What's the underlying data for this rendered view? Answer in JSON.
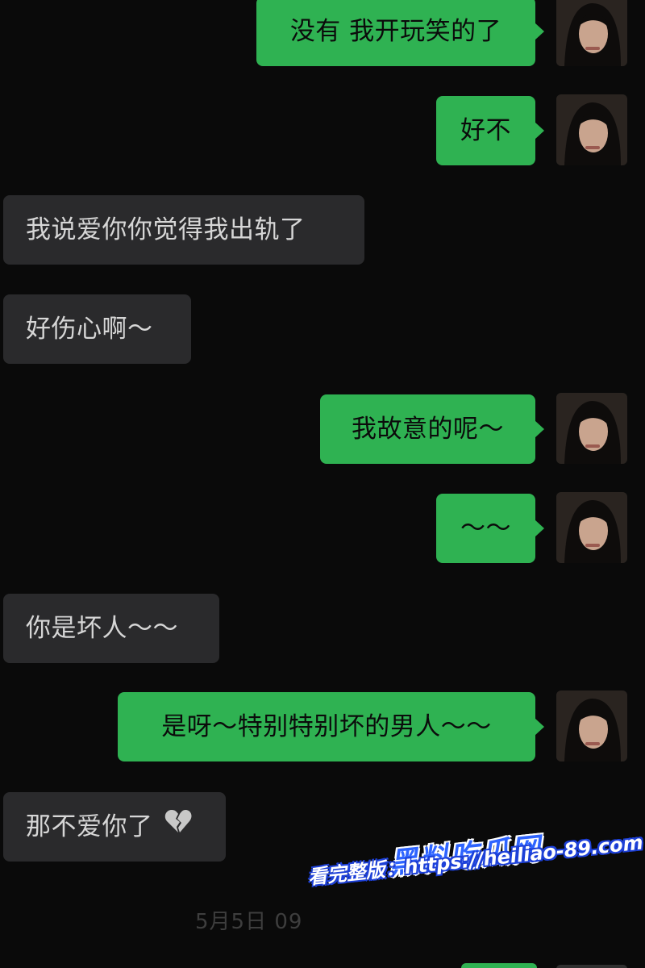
{
  "messages": [
    {
      "side": "sent",
      "text": "没有 我开玩笑的了"
    },
    {
      "side": "sent",
      "text": "好不"
    },
    {
      "side": "received",
      "text": "我说爱你你觉得我出轨了"
    },
    {
      "side": "received",
      "text": "好伤心啊～"
    },
    {
      "side": "sent",
      "text": "我故意的呢～"
    },
    {
      "side": "sent",
      "text": "～～"
    },
    {
      "side": "received",
      "text": "你是坏人～～"
    },
    {
      "side": "sent",
      "text": "是呀～特别特别坏的男人～～"
    },
    {
      "side": "received",
      "text": "那不爱你了",
      "emoji": "broken-heart-icon"
    }
  ],
  "timestamp": "5月5日 09",
  "watermark": {
    "brand": "黑料吃瓜网",
    "url_text": "看完整版：https://heiliao-89.com"
  },
  "colors": {
    "background": "#0a0a0a",
    "sent_bubble": "#2fb252",
    "received_bubble": "#2a2a2c",
    "watermark_blue": "#2e64ff"
  }
}
